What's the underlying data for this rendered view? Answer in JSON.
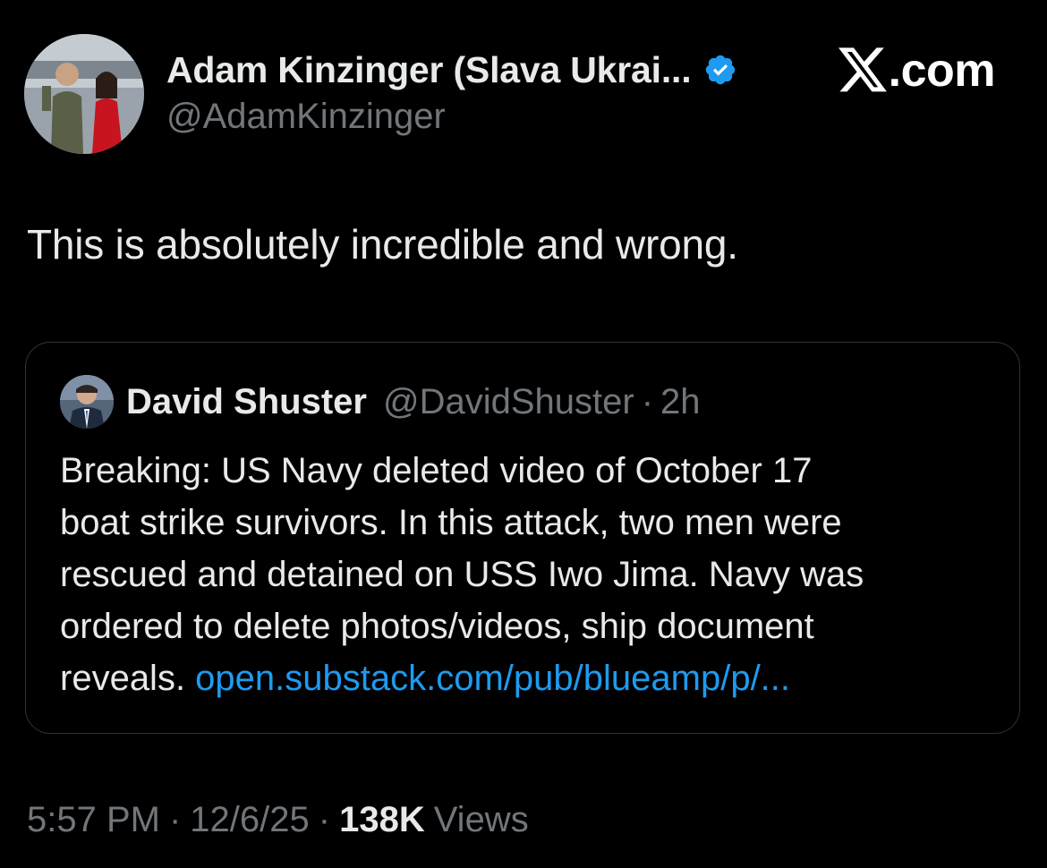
{
  "author": {
    "name": "Adam Kinzinger (Slava Ukrai...",
    "handle": "@AdamKinzinger",
    "verified_color": "#1d9bf0"
  },
  "brand": {
    "logo_icon": "x-logo-icon",
    "suffix": ".com"
  },
  "tweet": {
    "text": "This is absolutely incredible and wrong."
  },
  "quote": {
    "name": "David Shuster",
    "handle": "@DavidShuster",
    "separator": "·",
    "time": "2h",
    "text": "Breaking:  US Navy deleted video of October 17\nboat strike survivors.  In this attack, two men were\nrescued and detained on USS Iwo Jima.  Navy was\nordered to delete photos/videos, ship document\nreveals.  ",
    "link": "open.substack.com/pub/blueamp/p/..."
  },
  "meta": {
    "time": "5:57 PM",
    "separator": "·",
    "date": "12/6/25",
    "views_count": "138K",
    "views_label": "Views"
  },
  "colors": {
    "background": "#000000",
    "primary_text": "#e7e9ea",
    "secondary_text": "#71767b",
    "link": "#1d9bf0",
    "border": "#2f3336"
  }
}
